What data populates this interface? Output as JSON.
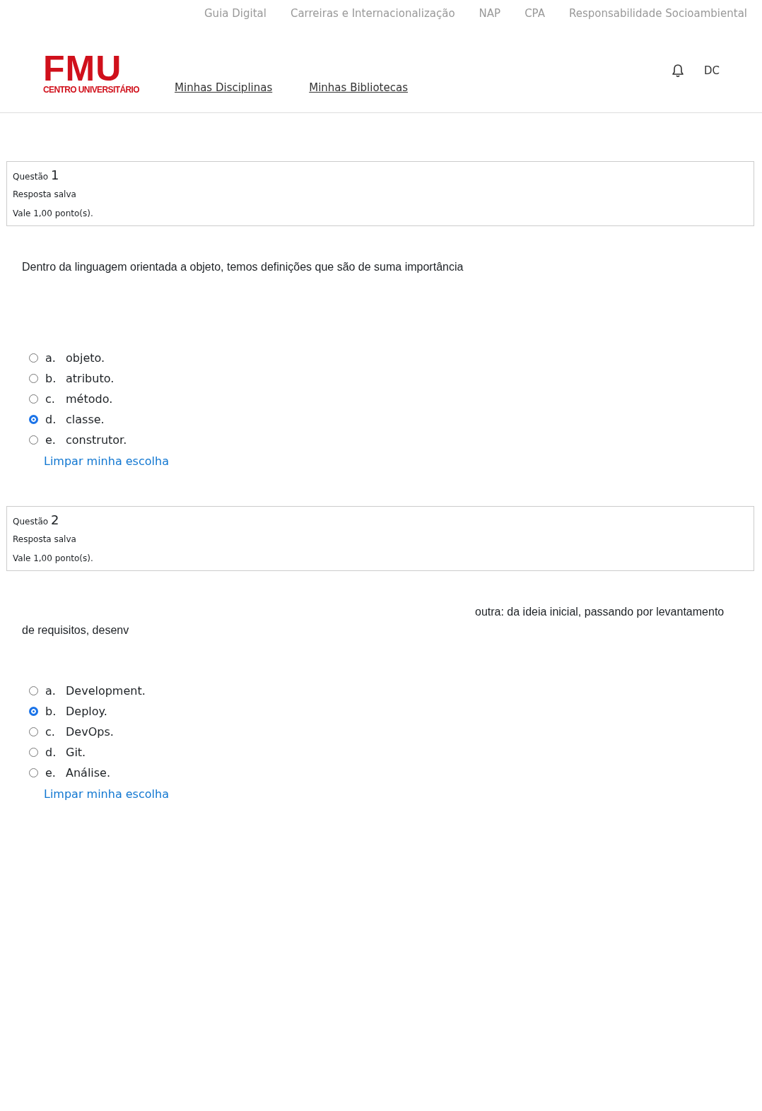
{
  "top_links": [
    "Guia Digital",
    "Carreiras e Internacionalização",
    "NAP",
    "CPA",
    "Responsabilidade Socioambiental"
  ],
  "logo": {
    "title": "FMU",
    "subtitle": "CENTRO UNIVERSITÁRIO"
  },
  "nav": [
    "Minhas Disciplinas",
    "Minhas Bibliotecas"
  ],
  "user": {
    "initials": "DC"
  },
  "questions": [
    {
      "label": "Questão",
      "number": "1",
      "status": "Resposta salva",
      "points": "Vale 1,00 ponto(s).",
      "text_lines": [
        {
          "text": "Dentro da linguagem orientada a objeto, temos definições que são de suma importância",
          "indented": false
        }
      ],
      "options": [
        {
          "letter": "a.",
          "text": "objeto.",
          "selected": false
        },
        {
          "letter": "b.",
          "text": "atributo.",
          "selected": false
        },
        {
          "letter": "c.",
          "text": "método.",
          "selected": false
        },
        {
          "letter": "d.",
          "text": "classe.",
          "selected": true
        },
        {
          "letter": "e.",
          "text": "construtor.",
          "selected": false
        }
      ],
      "clear_link": "Limpar minha escolha"
    },
    {
      "label": "Questão",
      "number": "2",
      "status": "Resposta salva",
      "points": "Vale 1,00 ponto(s).",
      "text_lines": [
        {
          "text": "outra: da ideia inicial, passando por levantamento",
          "indented": true
        },
        {
          "text": "de requisitos, desenv",
          "indented": false
        }
      ],
      "options": [
        {
          "letter": "a.",
          "text": "Development.",
          "selected": false
        },
        {
          "letter": "b.",
          "text": "Deploy.",
          "selected": true
        },
        {
          "letter": "c.",
          "text": "DevOps.",
          "selected": false
        },
        {
          "letter": "d.",
          "text": "Git.",
          "selected": false
        },
        {
          "letter": "e.",
          "text": "Análise.",
          "selected": false
        }
      ],
      "clear_link": "Limpar minha escolha"
    }
  ]
}
